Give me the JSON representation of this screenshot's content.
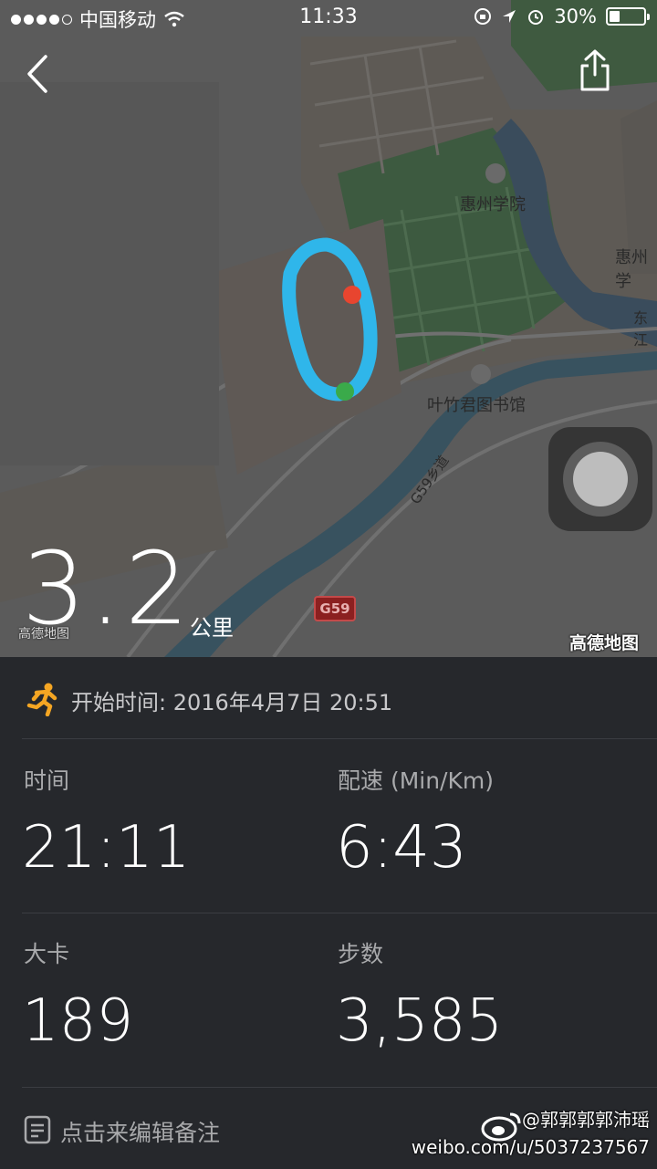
{
  "status_bar": {
    "carrier": "中国移动",
    "time": "11:33",
    "battery": "30%",
    "battery_level": 0.3,
    "signal_bars": 4
  },
  "map": {
    "labels": {
      "school": "惠州学院",
      "library": "叶竹君图书馆",
      "road": "G59乡道",
      "road_badge": "G59",
      "edge_label_1": "惠州学",
      "edge_label_2": "东江"
    },
    "provider": "高德地图",
    "provider_small": "高德地图"
  },
  "summary": {
    "distance": "3.2",
    "distance_unit": "公里"
  },
  "details": {
    "start_label": "开始时间:",
    "start_value": "2016年4月7日 20:51",
    "stats": [
      {
        "label": "时间",
        "value": "21:11"
      },
      {
        "label": "配速 (Min/Km)",
        "value": "6:43"
      },
      {
        "label": "大卡",
        "value": "189"
      },
      {
        "label": "步数",
        "value": "3,585"
      }
    ],
    "note": "点击来编辑备注"
  },
  "watermark": {
    "user": "@郭郭郭郭沛瑶",
    "url": "weibo.com/u/5037237567"
  },
  "colors": {
    "route": "#2fb6ea",
    "start_dot": "#3aaa4a",
    "end_dot": "#e8452f",
    "panel_bg": "#26282c",
    "runner_icon": "#f5a623"
  }
}
